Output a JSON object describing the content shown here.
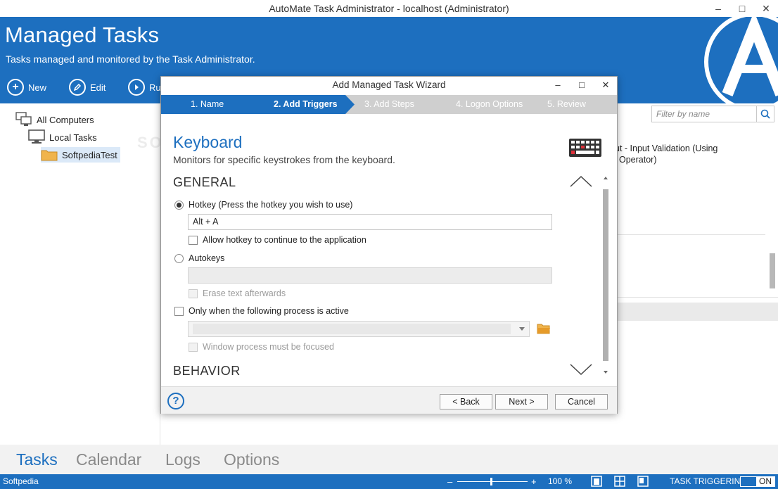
{
  "window": {
    "title": "AutoMate Task Administrator - localhost (Administrator)",
    "minimize": "–",
    "maximize": "□",
    "close": "✕"
  },
  "header": {
    "title": "Managed Tasks",
    "subtitle": "Tasks managed and monitored by the Task Administrator.",
    "toolbar": {
      "new_label": "New",
      "edit_label": "Edit",
      "run_label": "Ru"
    }
  },
  "tree": {
    "all_computers": "All Computers",
    "local_tasks": "Local Tasks",
    "selected": "SoftpediaTest"
  },
  "right_pane": {
    "filter_placeholder": "Filter by name",
    "item_text_line1": "ut - Input Validation (Using",
    "item_text_line2": "Operator)"
  },
  "dialog": {
    "title": "Add Managed Task Wizard",
    "steps": [
      {
        "label": "1.  Name"
      },
      {
        "label": "2.  Add Triggers"
      },
      {
        "label": "3.  Add Steps"
      },
      {
        "label": "4.  Logon Options"
      },
      {
        "label": "5.  Review"
      }
    ],
    "active_step": 1,
    "trigger_title": "Keyboard",
    "trigger_subtitle": "Monitors for specific keystrokes from the keyboard.",
    "general_heading": "GENERAL",
    "behavior_heading": "BEHAVIOR",
    "hotkey_label": "Hotkey (Press the hotkey you wish to use)",
    "hotkey_value": "Alt + A",
    "allow_hotkey_label": "Allow hotkey to continue to the application",
    "autokeys_label": "Autokeys",
    "autokeys_value": "",
    "erase_text_label": "Erase text afterwards",
    "only_process_label": "Only when the following process is active",
    "process_value": "",
    "window_focused_label": "Window process must be focused",
    "back_label": "< Back",
    "next_label": "Next >",
    "cancel_label": "Cancel",
    "help_label": "?"
  },
  "bottom_tabs": [
    {
      "label": "Tasks"
    },
    {
      "label": "Calendar"
    },
    {
      "label": "Logs"
    },
    {
      "label": "Options"
    }
  ],
  "status": {
    "left": "Softpedia",
    "zoom": "100 %",
    "zoom_minus": "–",
    "zoom_plus": "+",
    "task_triggering": "TASK TRIGGERING",
    "toggle": "ON"
  },
  "watermark": "SOFTPEDIA",
  "colors": {
    "brand": "#1d6fbf",
    "step_active": "#1d6fbf",
    "step_inactive": "#cfcfcf"
  }
}
